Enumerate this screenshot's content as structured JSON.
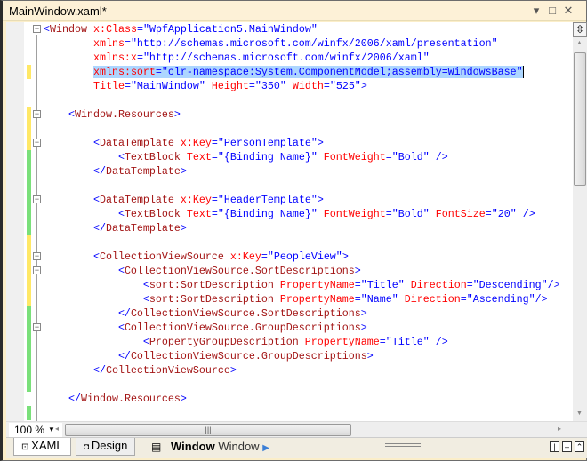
{
  "window": {
    "title": "MainWindow.xaml*",
    "menu_icon": "dropdown-icon",
    "max_icon": "maximize-icon",
    "close_icon": "close-icon"
  },
  "editor": {
    "lines": [
      [
        [
          "d",
          "<"
        ],
        [
          "t",
          "Window"
        ],
        [
          "a",
          " x:Class"
        ],
        [
          "d",
          "="
        ],
        [
          "v",
          "\"WpfApplication5.MainWindow\""
        ]
      ],
      [
        [
          "a",
          "        xmlns"
        ],
        [
          "d",
          "="
        ],
        [
          "v",
          "\"http://schemas.microsoft.com/winfx/2006/xaml/presentation\""
        ]
      ],
      [
        [
          "a",
          "        xmlns:x"
        ],
        [
          "d",
          "="
        ],
        [
          "v",
          "\"http://schemas.microsoft.com/winfx/2006/xaml\""
        ]
      ],
      [
        [
          "a",
          "        xmlns:sort"
        ],
        [
          "d",
          "="
        ],
        [
          "v",
          "\"clr-namespace:System.ComponentModel;assembly=WindowsBase\""
        ]
      ],
      [
        [
          "a",
          "        Title"
        ],
        [
          "d",
          "="
        ],
        [
          "v",
          "\"MainWindow\""
        ],
        [
          "a",
          " Height"
        ],
        [
          "d",
          "="
        ],
        [
          "v",
          "\"350\""
        ],
        [
          "a",
          " Width"
        ],
        [
          "d",
          "="
        ],
        [
          "v",
          "\"525\""
        ],
        [
          "d",
          ">"
        ]
      ],
      [],
      [
        [
          "d",
          "    <"
        ],
        [
          "t",
          "Window.Resources"
        ],
        [
          "d",
          ">"
        ]
      ],
      [],
      [
        [
          "d",
          "        <"
        ],
        [
          "t",
          "DataTemplate"
        ],
        [
          "a",
          " x:Key"
        ],
        [
          "d",
          "="
        ],
        [
          "v",
          "\"PersonTemplate\""
        ],
        [
          "d",
          ">"
        ]
      ],
      [
        [
          "d",
          "            <"
        ],
        [
          "t",
          "TextBlock"
        ],
        [
          "a",
          " Text"
        ],
        [
          "d",
          "="
        ],
        [
          "v",
          "\"{Binding Name}\""
        ],
        [
          "a",
          " FontWeight"
        ],
        [
          "d",
          "="
        ],
        [
          "v",
          "\"Bold\""
        ],
        [
          "d",
          " />"
        ]
      ],
      [
        [
          "d",
          "        </"
        ],
        [
          "t",
          "DataTemplate"
        ],
        [
          "d",
          ">"
        ]
      ],
      [],
      [
        [
          "d",
          "        <"
        ],
        [
          "t",
          "DataTemplate"
        ],
        [
          "a",
          " x:Key"
        ],
        [
          "d",
          "="
        ],
        [
          "v",
          "\"HeaderTemplate\""
        ],
        [
          "d",
          ">"
        ]
      ],
      [
        [
          "d",
          "            <"
        ],
        [
          "t",
          "TextBlock"
        ],
        [
          "a",
          " Text"
        ],
        [
          "d",
          "="
        ],
        [
          "v",
          "\"{Binding Name}\""
        ],
        [
          "a",
          " FontWeight"
        ],
        [
          "d",
          "="
        ],
        [
          "v",
          "\"Bold\""
        ],
        [
          "a",
          " FontSize"
        ],
        [
          "d",
          "="
        ],
        [
          "v",
          "\"20\""
        ],
        [
          "d",
          " />"
        ]
      ],
      [
        [
          "d",
          "        </"
        ],
        [
          "t",
          "DataTemplate"
        ],
        [
          "d",
          ">"
        ]
      ],
      [],
      [
        [
          "d",
          "        <"
        ],
        [
          "t",
          "CollectionViewSource"
        ],
        [
          "a",
          " x:Key"
        ],
        [
          "d",
          "="
        ],
        [
          "v",
          "\"PeopleView\""
        ],
        [
          "d",
          ">"
        ]
      ],
      [
        [
          "d",
          "            <"
        ],
        [
          "t",
          "CollectionViewSource.SortDescriptions"
        ],
        [
          "d",
          ">"
        ]
      ],
      [
        [
          "d",
          "                <"
        ],
        [
          "t",
          "sort:SortDescription"
        ],
        [
          "a",
          " PropertyName"
        ],
        [
          "d",
          "="
        ],
        [
          "v",
          "\"Title\""
        ],
        [
          "a",
          " Direction"
        ],
        [
          "d",
          "="
        ],
        [
          "v",
          "\"Descending\""
        ],
        [
          "d",
          "/>"
        ]
      ],
      [
        [
          "d",
          "                <"
        ],
        [
          "t",
          "sort:SortDescription"
        ],
        [
          "a",
          " PropertyName"
        ],
        [
          "d",
          "="
        ],
        [
          "v",
          "\"Name\""
        ],
        [
          "a",
          " Direction"
        ],
        [
          "d",
          "="
        ],
        [
          "v",
          "\"Ascending\""
        ],
        [
          "d",
          "/>"
        ]
      ],
      [
        [
          "d",
          "            </"
        ],
        [
          "t",
          "CollectionViewSource.SortDescriptions"
        ],
        [
          "d",
          ">"
        ]
      ],
      [
        [
          "d",
          "            <"
        ],
        [
          "t",
          "CollectionViewSource.GroupDescriptions"
        ],
        [
          "d",
          ">"
        ]
      ],
      [
        [
          "d",
          "                <"
        ],
        [
          "t",
          "PropertyGroupDescription"
        ],
        [
          "a",
          " PropertyName"
        ],
        [
          "d",
          "="
        ],
        [
          "v",
          "\"Title\""
        ],
        [
          "d",
          " />"
        ]
      ],
      [
        [
          "d",
          "            </"
        ],
        [
          "t",
          "CollectionViewSource.GroupDescriptions"
        ],
        [
          "d",
          ">"
        ]
      ],
      [
        [
          "d",
          "        </"
        ],
        [
          "t",
          "CollectionViewSource"
        ],
        [
          "d",
          ">"
        ]
      ],
      [],
      [
        [
          "d",
          "    </"
        ],
        [
          "t",
          "Window.Resources"
        ],
        [
          "d",
          ">"
        ]
      ],
      []
    ],
    "selected_line": 4,
    "fold_lines": [
      1,
      7,
      9,
      13,
      17,
      18,
      22
    ],
    "change_bars": [
      {
        "from": 4,
        "to": 4,
        "state": "unsaved",
        "color": "#ffe866"
      },
      {
        "from": 7,
        "to": 9,
        "state": "unsaved",
        "color": "#ffe866"
      },
      {
        "from": 10,
        "to": 15,
        "state": "saved",
        "color": "#7ae07a"
      },
      {
        "from": 16,
        "to": 20,
        "state": "unsaved",
        "color": "#ffe866"
      },
      {
        "from": 21,
        "to": 26,
        "state": "saved",
        "color": "#7ae07a"
      },
      {
        "from": 28,
        "to": 28,
        "state": "saved",
        "color": "#7ae07a"
      }
    ]
  },
  "statusbar": {
    "zoom": "100 %",
    "tabs": [
      "XAML",
      "Design"
    ],
    "breadcrumb_bold": "Window",
    "breadcrumb": "Window"
  }
}
